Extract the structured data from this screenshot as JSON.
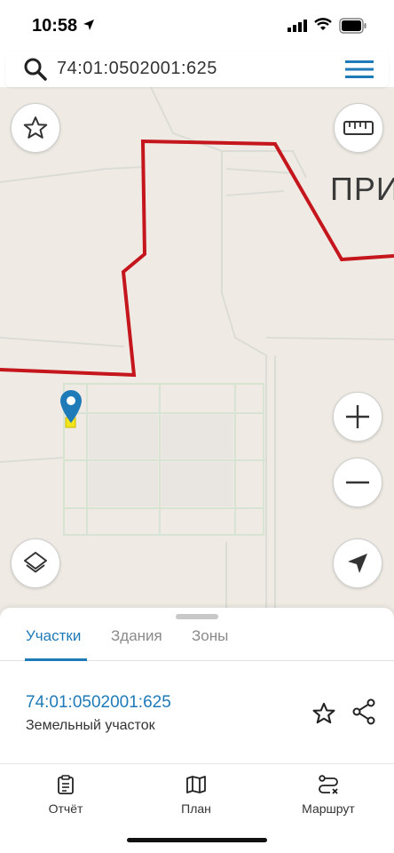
{
  "status_bar": {
    "time": "10:58",
    "icons": [
      "location-arrow-icon",
      "signal-icon",
      "wifi-icon",
      "battery-icon"
    ]
  },
  "search": {
    "value": "74:01:0502001:625",
    "icons": [
      "search-icon",
      "menu-icon"
    ]
  },
  "map": {
    "place_label": "ПРИУ",
    "buttons": [
      "favorite-star-icon",
      "ruler-icon",
      "zoom-in-icon",
      "zoom-out-icon",
      "layers-icon",
      "my-location-icon"
    ],
    "boundary_color": "#c4161c",
    "marker_color": "#1f7ab8"
  },
  "sheet": {
    "tabs": [
      {
        "label": "Участки",
        "active": true
      },
      {
        "label": "Здания",
        "active": false
      },
      {
        "label": "Зоны",
        "active": false
      }
    ],
    "result": {
      "cadastral_number": "74:01:0502001:625",
      "type": "Земельный участок"
    }
  },
  "bottom_nav": {
    "items": [
      {
        "label": "Отчёт",
        "icon": "report-icon"
      },
      {
        "label": "План",
        "icon": "map-plan-icon"
      },
      {
        "label": "Маршрут",
        "icon": "route-icon"
      }
    ]
  },
  "colors": {
    "accent": "#1f7ab8",
    "map_background": "#efebe4",
    "boundary": "#c4161c"
  }
}
